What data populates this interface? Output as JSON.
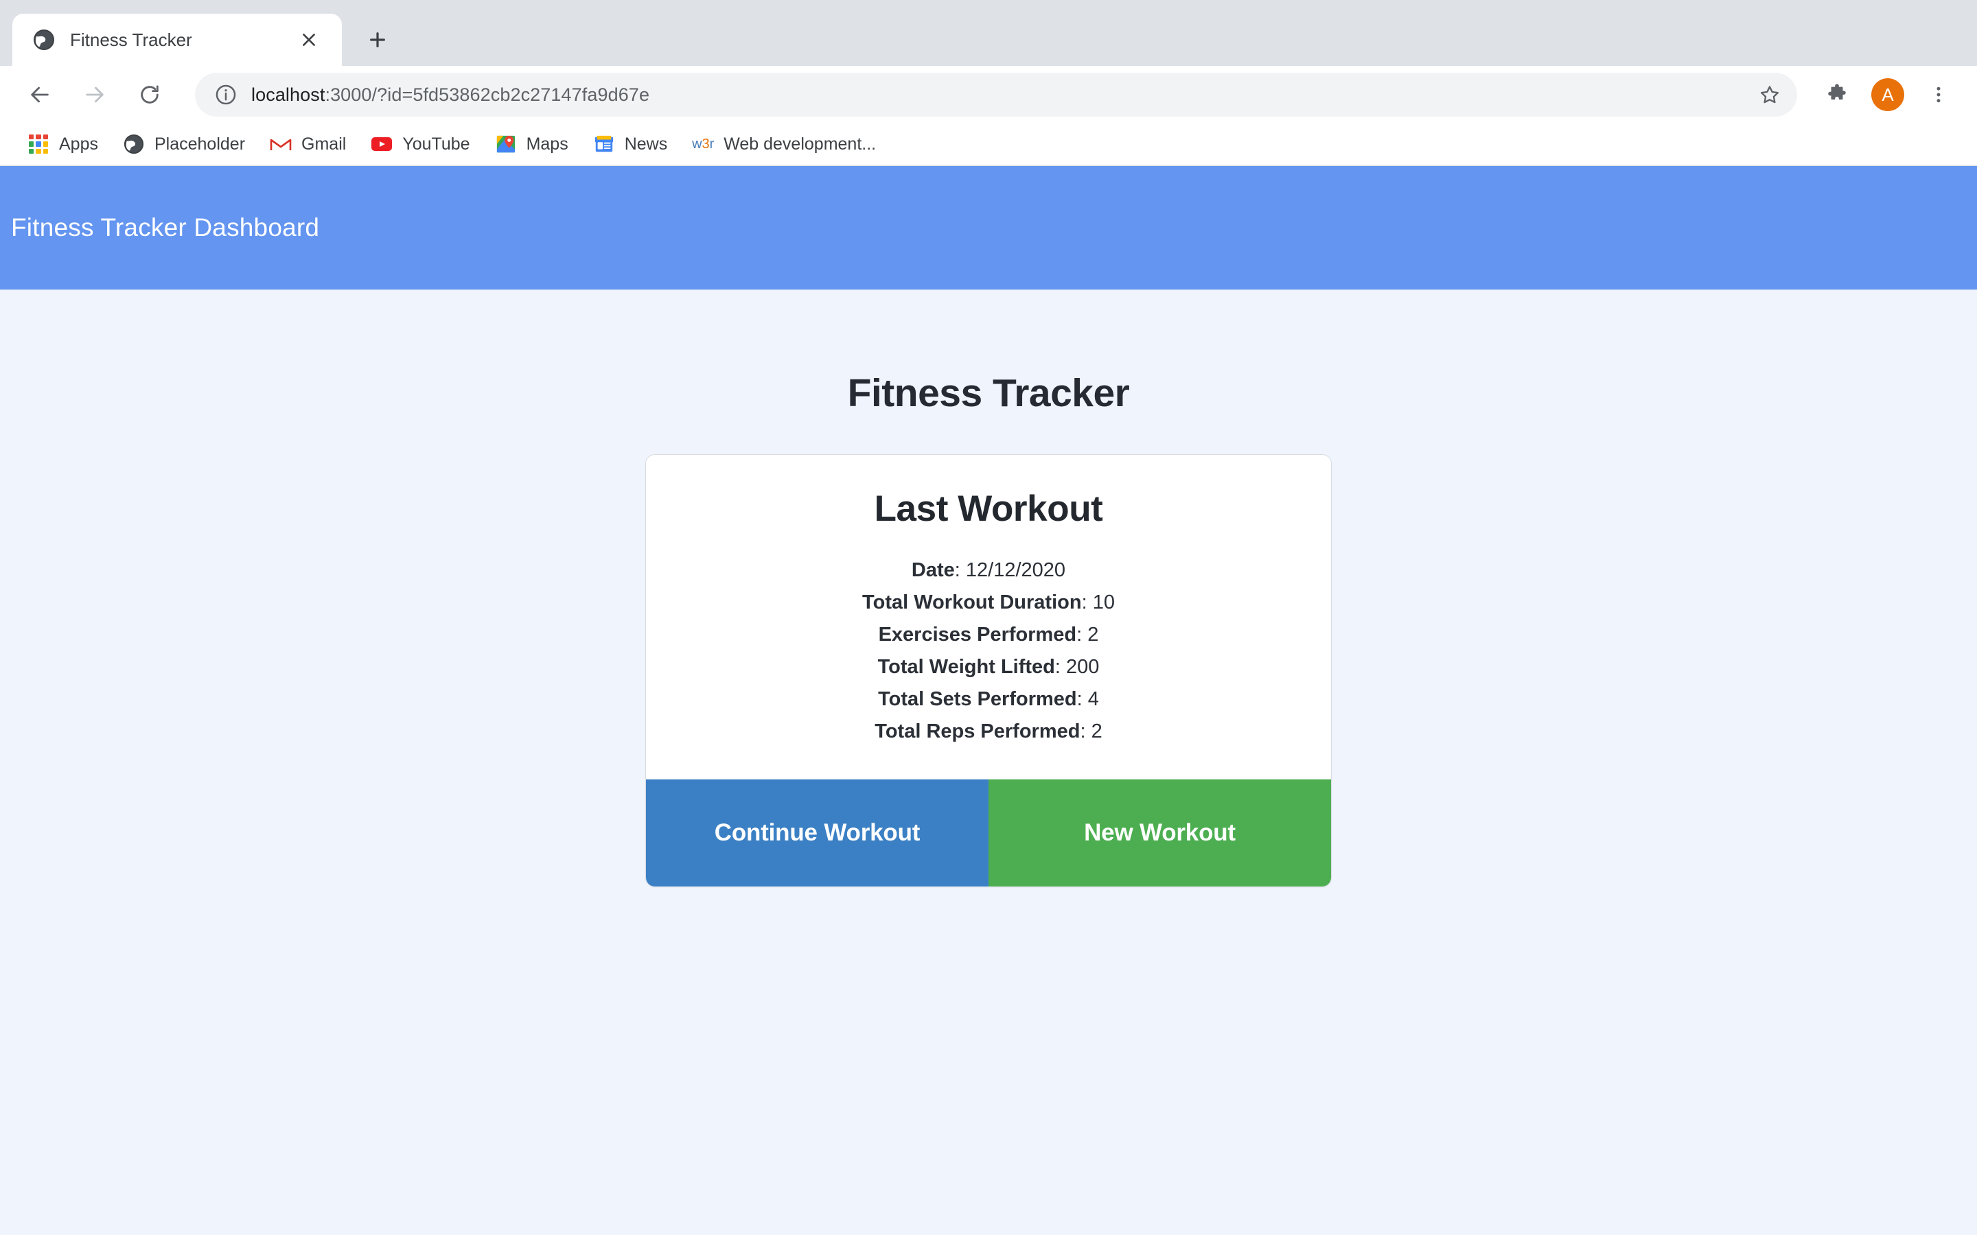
{
  "browser": {
    "tab": {
      "title": "Fitness Tracker",
      "favicon_name": "globe-icon",
      "close_label": "✕"
    },
    "new_tab_label": "+",
    "toolbar": {
      "back_label": "←",
      "forward_label": "→",
      "reload_label": "↻",
      "url_host": "localhost",
      "url_rest": ":3000/?id=5fd53862cb2c27147fa9d67e",
      "url_full": "localhost:3000/?id=5fd53862cb2c27147fa9d67e",
      "star_label": "☆",
      "profile_initial": "A",
      "menu_label": "⋮"
    },
    "bookmarks": [
      {
        "label": "Apps",
        "icon": "apps-grid-icon"
      },
      {
        "label": "Placeholder",
        "icon": "globe-icon"
      },
      {
        "label": "Gmail",
        "icon": "gmail-icon"
      },
      {
        "label": "YouTube",
        "icon": "youtube-icon"
      },
      {
        "label": "Maps",
        "icon": "maps-icon"
      },
      {
        "label": "News",
        "icon": "news-icon"
      },
      {
        "label": "Web development...",
        "icon": "w3r-icon"
      }
    ]
  },
  "app": {
    "appbar_title": "Fitness Tracker Dashboard",
    "page_title": "Fitness Tracker",
    "card": {
      "title": "Last Workout",
      "stats": [
        {
          "label": "Date",
          "value": "12/12/2020"
        },
        {
          "label": "Total Workout Duration",
          "value": "10"
        },
        {
          "label": "Exercises Performed",
          "value": "2"
        },
        {
          "label": "Total Weight Lifted",
          "value": "200"
        },
        {
          "label": "Total Sets Performed",
          "value": "4"
        },
        {
          "label": "Total Reps Performed",
          "value": "2"
        }
      ],
      "continue_label": "Continue Workout",
      "new_label": "New Workout"
    }
  },
  "colors": {
    "appbar": "#6495f0",
    "page_bg": "#f0f4fd",
    "continue_btn": "#3b80c4",
    "new_btn": "#4cae50",
    "avatar": "#e8710a",
    "tabstrip": "#dee1e6"
  }
}
